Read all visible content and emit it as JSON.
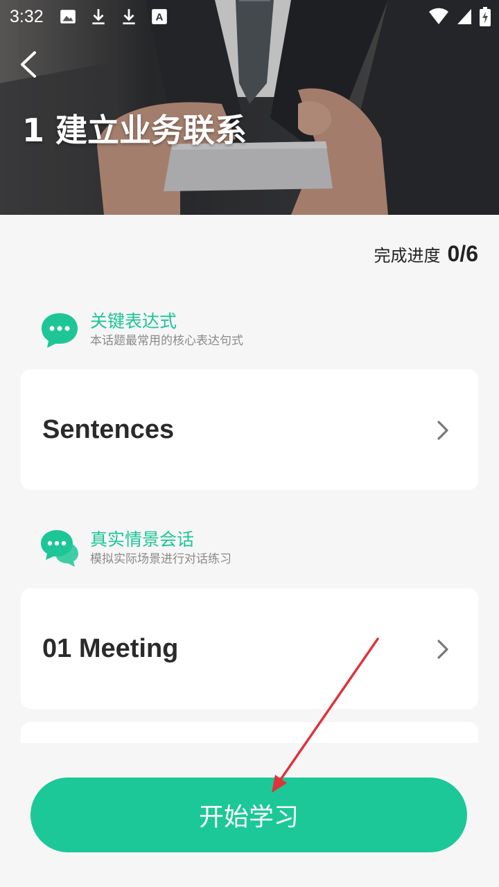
{
  "status_bar": {
    "time": "3:32",
    "left_icons": [
      "image-icon",
      "download-icon",
      "download-icon",
      "font-icon"
    ],
    "right_icons": [
      "wifi-icon",
      "signal-icon",
      "battery-charging-icon"
    ]
  },
  "header": {
    "title": "1 建立业务联系",
    "back_icon": "chevron-left-icon"
  },
  "progress": {
    "label": "完成进度",
    "value": "0/6"
  },
  "sections": [
    {
      "title": "关键表达式",
      "subtitle": "本话题最常用的核心表达句式",
      "icon": "chat-bubble-icon",
      "cards": [
        {
          "label": "Sentences"
        }
      ]
    },
    {
      "title": "真实情景会话",
      "subtitle": "模拟实际场景进行对话练习",
      "icon": "chat-bubbles-icon",
      "cards": [
        {
          "label": "01 Meeting"
        }
      ]
    }
  ],
  "start_button": {
    "label": "开始学习"
  },
  "colors": {
    "accent": "#1cc898",
    "annotation_arrow": "#e0323a"
  }
}
